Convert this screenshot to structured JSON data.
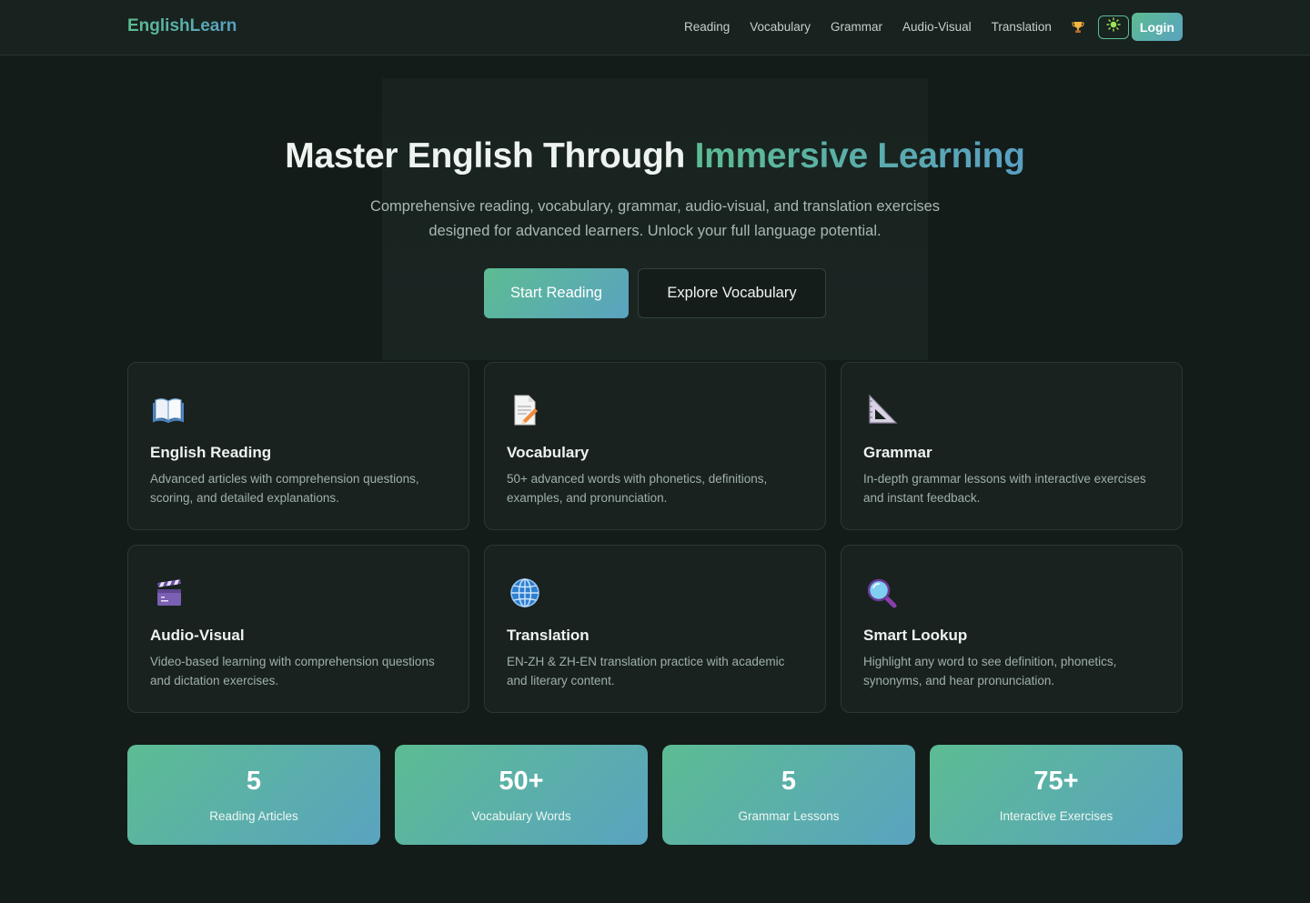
{
  "nav": {
    "brand": "EnglishLearn",
    "links": [
      "Reading",
      "Vocabulary",
      "Grammar",
      "Audio-Visual",
      "Translation"
    ],
    "trophy_icon": "trophy-icon",
    "theme_icon": "sun-icon",
    "login_label": "Login"
  },
  "hero": {
    "title_part1": "Master English Through ",
    "title_accent": "Immersive Learning",
    "subtitle": "Comprehensive reading, vocabulary, grammar, audio-visual, and translation exercises designed for advanced learners. Unlock your full language potential.",
    "primary_button": "Start Reading",
    "secondary_button": "Explore Vocabulary"
  },
  "features": [
    {
      "icon": "book-icon",
      "title": "English Reading",
      "desc": "Advanced articles with comprehension questions, scoring, and detailed explanations."
    },
    {
      "icon": "memo-icon",
      "title": "Vocabulary",
      "desc": "50+ advanced words with phonetics, definitions, examples, and pronunciation."
    },
    {
      "icon": "triangle-ruler-icon",
      "title": "Grammar",
      "desc": "In-depth grammar lessons with interactive exercises and instant feedback."
    },
    {
      "icon": "clapperboard-icon",
      "title": "Audio-Visual",
      "desc": "Video-based learning with comprehension questions and dictation exercises."
    },
    {
      "icon": "globe-icon",
      "title": "Translation",
      "desc": "EN-ZH & ZH-EN translation practice with academic and literary content."
    },
    {
      "icon": "magnifier-icon",
      "title": "Smart Lookup",
      "desc": "Highlight any word to see definition, phonetics, synonyms, and hear pronunciation."
    }
  ],
  "stats": [
    {
      "value": "5",
      "label": "Reading Articles"
    },
    {
      "value": "50+",
      "label": "Vocabulary Words"
    },
    {
      "value": "5",
      "label": "Grammar Lessons"
    },
    {
      "value": "75+",
      "label": "Interactive Exercises"
    }
  ],
  "colors": {
    "accent_green": "#5cbc92",
    "accent_blue": "#5aa3c0",
    "background": "#131c19",
    "card": "#19221f"
  }
}
